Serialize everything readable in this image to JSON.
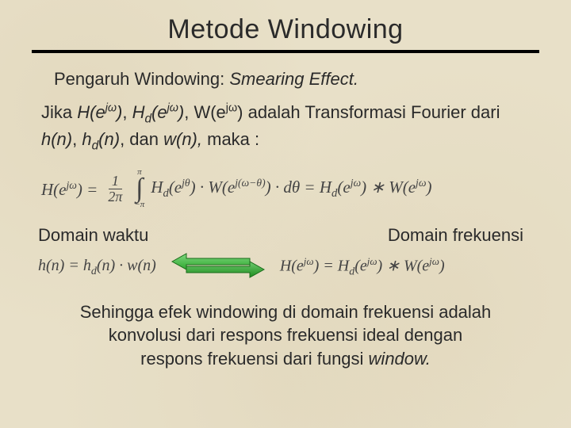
{
  "title": "Metode Windowing",
  "subtitle_plain": "Pengaruh Windowing: ",
  "subtitle_ital": "Smearing Effect.",
  "para_parts": {
    "p1": "Jika ",
    "H": "H(e",
    "jw": "jω",
    "close": ")",
    "comma": ", ",
    "Hd": "H",
    "dsub": "d",
    "ebr": "(e",
    "W": "W(e",
    "p2": " adalah Transformasi Fourier dari ",
    "hn": "h(n)",
    "hdn_h": "h",
    "hdn_n": "(n)",
    "dan": ", dan ",
    "wn": "w(n),",
    "maka": " maka :"
  },
  "eq_main": {
    "lhs": "H(e",
    "jw": "jω",
    "eq": ") =",
    "one": "1",
    "twopi": "2π",
    "ulim": "π",
    "llim": "−π",
    "Hd": "H",
    "d": "d",
    "ejth": "(e",
    "jth": "jθ",
    "mid": ") · W(e",
    "jwmth": "j(ω−θ)",
    "dth": ") · dθ = ",
    "Hd2": "H",
    "ejw2": "(e",
    "star": ") ∗ W(e",
    "end": ")"
  },
  "domains": {
    "time": "Domain waktu",
    "freq": "Domain frekuensi"
  },
  "eq_time": {
    "hn": "h(n) = h",
    "d": "d",
    "rest": "(n) · w(n)"
  },
  "eq_freq": {
    "H": "H(e",
    "jw": "jω",
    "eq": ") = H",
    "d": "d",
    "ebr": "(e",
    "star": ") ∗ W(e",
    "end": ")"
  },
  "conclusion": {
    "l1": "Sehingga efek windowing di domain frekuensi adalah",
    "l2": "konvolusi dari respons frekuensi ideal dengan",
    "l3a": "respons frekuensi dari fungsi ",
    "l3b": "window."
  }
}
